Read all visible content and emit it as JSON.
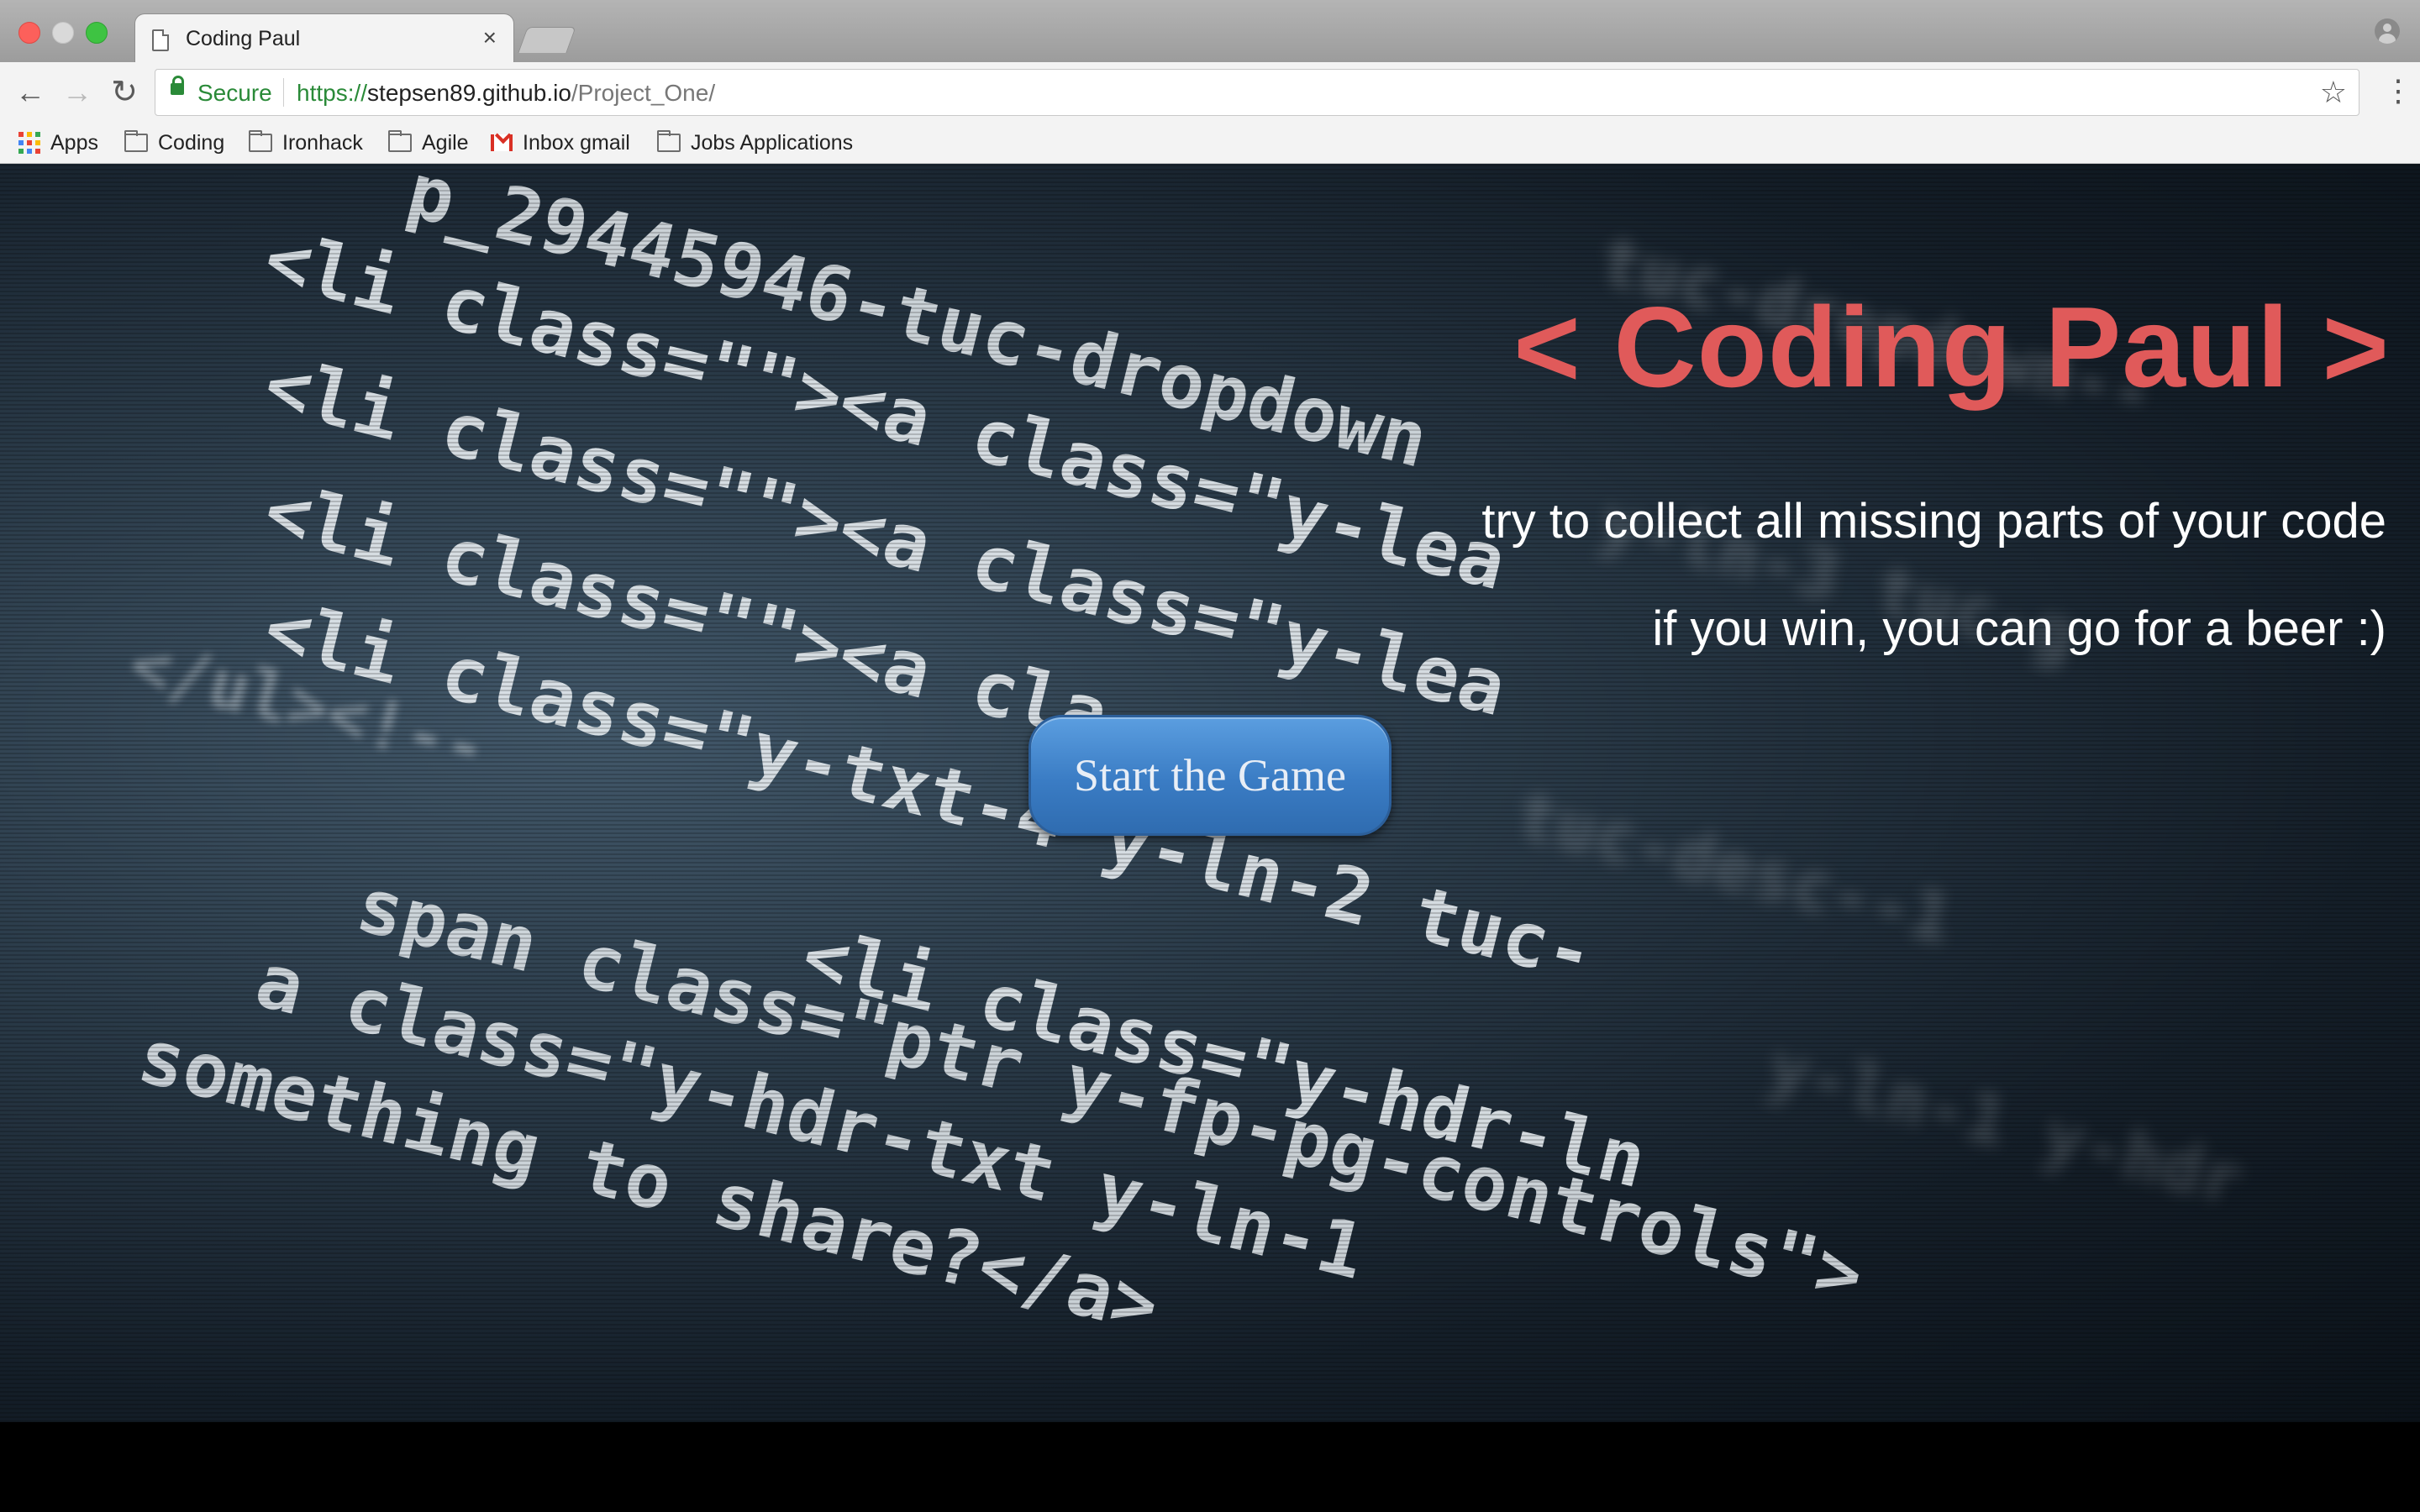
{
  "browser": {
    "tab": {
      "title": "Coding Paul",
      "close_label": "×"
    },
    "toolbar": {
      "back_label": "←",
      "forward_label": "→",
      "reload_label": "↻",
      "secure_label": "Secure",
      "url_scheme": "https://",
      "url_host": "stepsen89.github.io",
      "url_path": "/Project_One/",
      "star_label": "☆",
      "menu_label": "⋮"
    },
    "bookmarks": [
      {
        "label": "Apps",
        "icon": "apps-icon"
      },
      {
        "label": "Coding",
        "icon": "folder-icon"
      },
      {
        "label": "Ironhack",
        "icon": "folder-icon"
      },
      {
        "label": "Agile",
        "icon": "folder-icon"
      },
      {
        "label": "Inbox gmail",
        "icon": "gmail-icon"
      },
      {
        "label": "Jobs Applications",
        "icon": "folder-icon"
      }
    ]
  },
  "page": {
    "title": "< Coding Paul >",
    "subtitle_line1": "try to collect all missing parts of your code",
    "subtitle_line2": "if you win, you can go for a beer :)",
    "start_button_label": "Start the Game",
    "title_color": "#e05a5a",
    "button_color": "#3a7cc4"
  }
}
